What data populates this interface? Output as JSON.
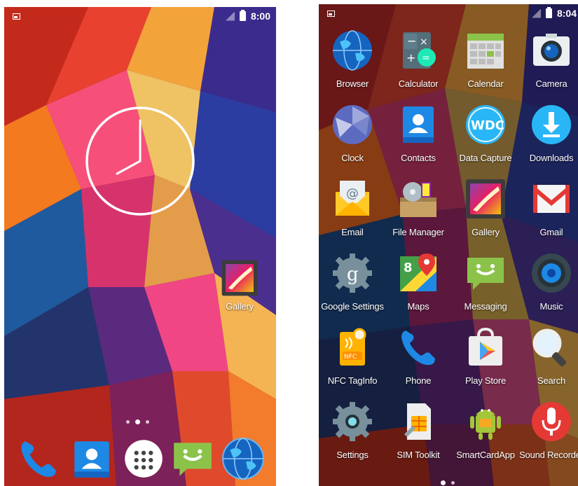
{
  "home": {
    "status": {
      "time": "8:00",
      "icons": [
        "image-icon",
        "no-signal-icon",
        "battery-icon"
      ]
    },
    "clock": {
      "hour_hand_deg": 240,
      "minute_hand_deg": 0
    },
    "shortcut": {
      "label": "Gallery",
      "icon": "gallery-icon"
    },
    "page_count": 3,
    "active_page": 2,
    "dock": [
      {
        "name": "phone",
        "icon": "phone-icon"
      },
      {
        "name": "contacts",
        "icon": "contacts-icon"
      },
      {
        "name": "all-apps",
        "icon": "apps-grid-icon"
      },
      {
        "name": "messaging",
        "icon": "messaging-icon"
      },
      {
        "name": "browser",
        "icon": "globe-icon"
      }
    ]
  },
  "drawer": {
    "status": {
      "time": "8:04",
      "icons": [
        "image-icon",
        "no-signal-icon",
        "battery-icon"
      ]
    },
    "apps": [
      {
        "label": "Browser",
        "icon": "globe-icon"
      },
      {
        "label": "Calculator",
        "icon": "calculator-icon"
      },
      {
        "label": "Calendar",
        "icon": "calendar-icon"
      },
      {
        "label": "Camera",
        "icon": "camera-icon"
      },
      {
        "label": "Clock",
        "icon": "clock-icon"
      },
      {
        "label": "Contacts",
        "icon": "contacts-icon"
      },
      {
        "label": "Data Capture",
        "icon": "wdc-icon"
      },
      {
        "label": "Downloads",
        "icon": "download-icon"
      },
      {
        "label": "Email",
        "icon": "email-icon"
      },
      {
        "label": "File Manager",
        "icon": "file-manager-icon"
      },
      {
        "label": "Gallery",
        "icon": "gallery-icon"
      },
      {
        "label": "Gmail",
        "icon": "gmail-icon"
      },
      {
        "label": "Google Settings",
        "icon": "google-settings-icon"
      },
      {
        "label": "Maps",
        "icon": "maps-icon"
      },
      {
        "label": "Messaging",
        "icon": "messaging-icon"
      },
      {
        "label": "Music",
        "icon": "music-icon"
      },
      {
        "label": "NFC TagInfo",
        "icon": "nfc-icon"
      },
      {
        "label": "Phone",
        "icon": "phone-icon"
      },
      {
        "label": "Play Store",
        "icon": "play-store-icon"
      },
      {
        "label": "Search",
        "icon": "search-icon"
      },
      {
        "label": "Settings",
        "icon": "settings-icon"
      },
      {
        "label": "SIM Toolkit",
        "icon": "sim-toolkit-icon"
      },
      {
        "label": "SmartCardApp",
        "icon": "smartcard-icon"
      },
      {
        "label": "Sound Recorder",
        "icon": "sound-recorder-icon"
      }
    ],
    "page_count": 2,
    "active_page": 1
  },
  "colors": {
    "label": "#ffffff",
    "status": "#ffffff"
  }
}
